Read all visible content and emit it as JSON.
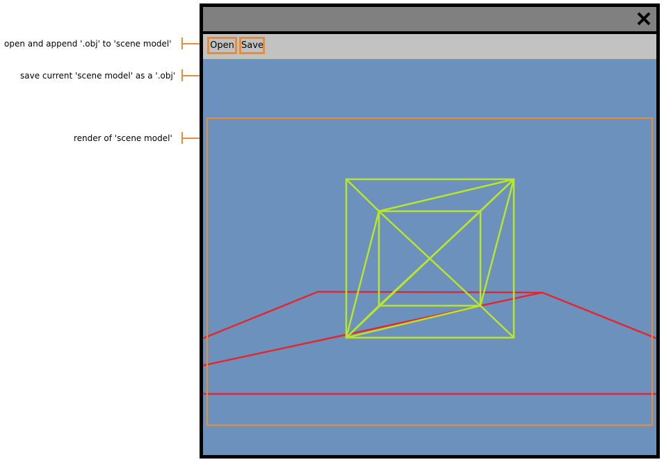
{
  "annotations": {
    "open": "open and append '.obj' to 'scene model'",
    "save": "save current 'scene model' as a '.obj'",
    "render": "render of 'scene model'"
  },
  "window": {
    "close_icon": "close-icon",
    "close_label": "✕"
  },
  "toolbar": {
    "open_label": "Open",
    "save_label": "Save"
  },
  "colors": {
    "annotation": "#f08a30",
    "viewport_bg": "#6d91bd",
    "model": "#b8e62a",
    "floor": "#e0282e",
    "titlebar": "#808080",
    "toolbar": "#c2c2c2"
  }
}
